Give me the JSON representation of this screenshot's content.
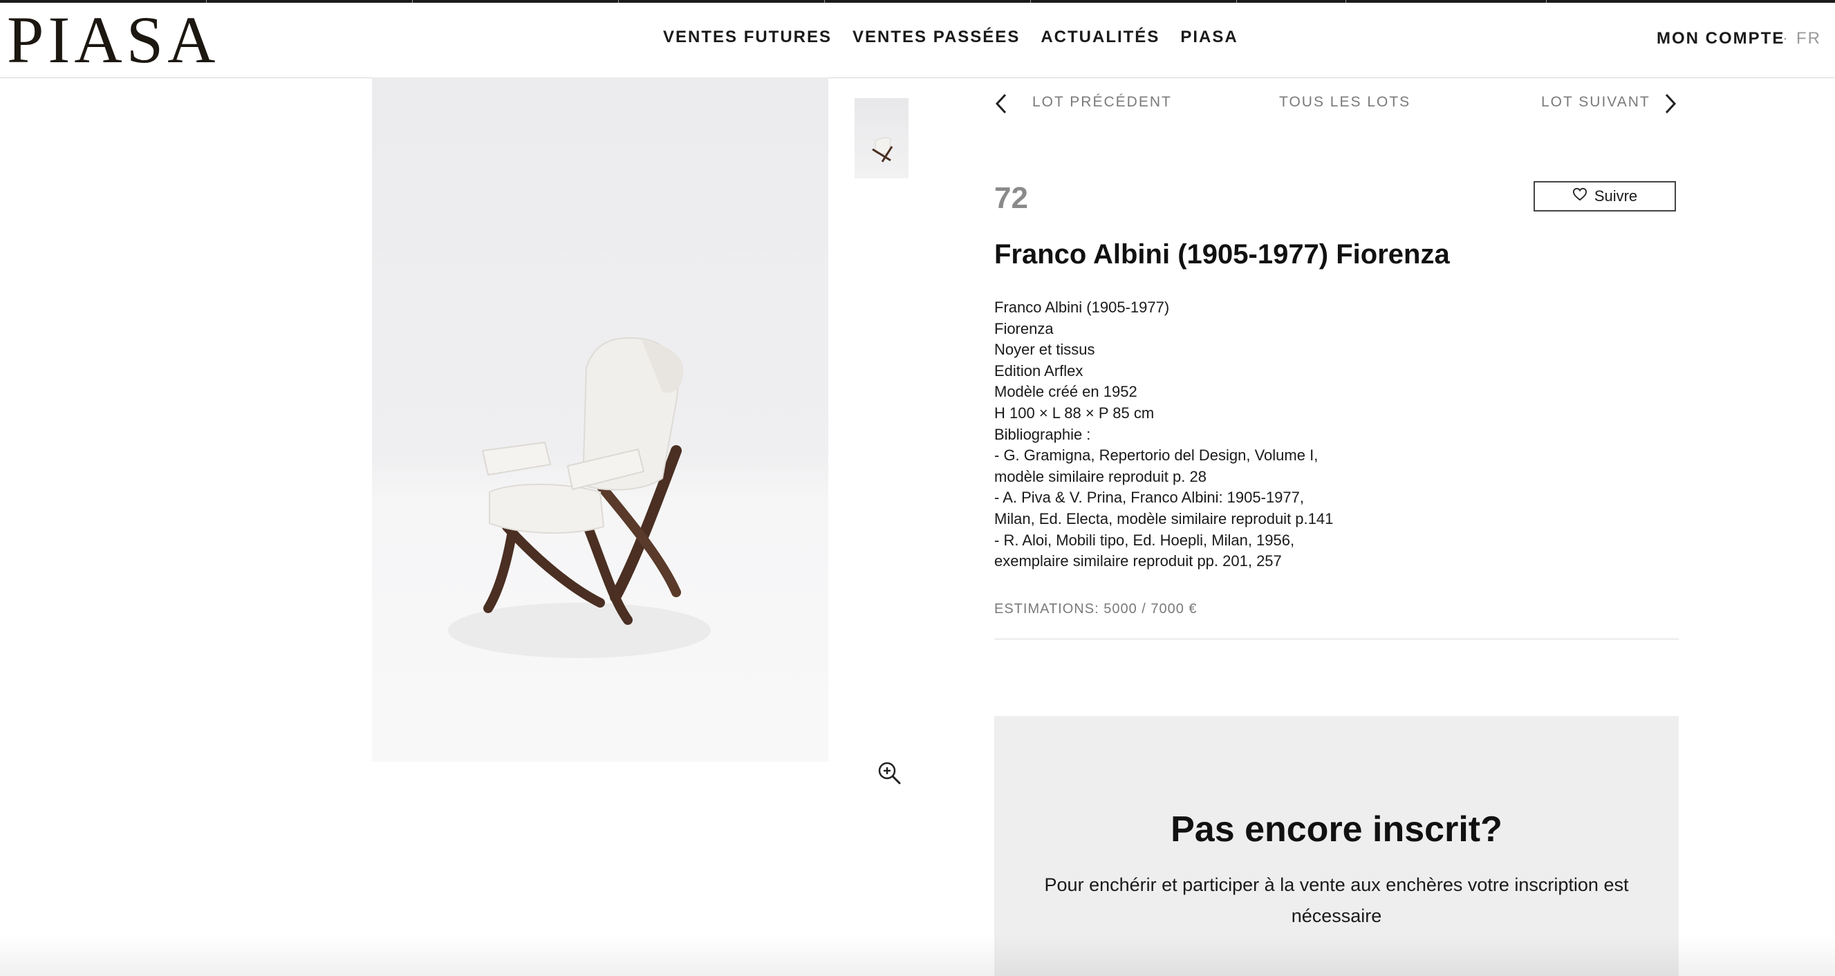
{
  "header": {
    "logo": "PIASA",
    "nav": [
      "VENTES FUTURES",
      "VENTES PASSÉES",
      "ACTUALITÉS",
      "PIASA"
    ],
    "account": "MON COMPTE",
    "separator": "·",
    "language": "FR"
  },
  "lot_nav": {
    "previous": "LOT PRÉCÉDENT",
    "all": "TOUS LES LOTS",
    "next": "LOT SUIVANT"
  },
  "lot": {
    "number": "72",
    "follow_label": "Suivre",
    "title": "Franco Albini (1905-1977) Fiorenza",
    "description": [
      "Franco Albini (1905-1977)",
      "Fiorenza",
      "Noyer et tissus",
      "Edition Arflex",
      "Modèle créé en 1952",
      "H 100 × L 88 × P 85 cm",
      "Bibliographie :",
      "- G. Gramigna, Repertorio del Design, Volume I,",
      "modèle similaire reproduit p. 28",
      "- A. Piva & V. Prina, Franco Albini: 1905-1977,",
      "Milan, Ed. Electa, modèle similaire reproduit p.141",
      "- R. Aloi, Mobili tipo, Ed. Hoepli, Milan, 1956,",
      "exemplaire similaire reproduit pp. 201, 257"
    ],
    "estimate": "ESTIMATIONS: 5000 / 7000 €"
  },
  "register": {
    "title": "Pas encore inscrit?",
    "text": "Pour enchérir et participer à la vente aux enchères votre inscription est nécessaire"
  },
  "icons": {
    "follow": "heart-outline-icon",
    "zoom": "zoom-in-icon",
    "prev": "chevron-left-icon",
    "next": "chevron-right-icon"
  },
  "colors": {
    "logo": "#1c1710",
    "muted": "#7a7a7a",
    "panel": "#eeeeee"
  }
}
